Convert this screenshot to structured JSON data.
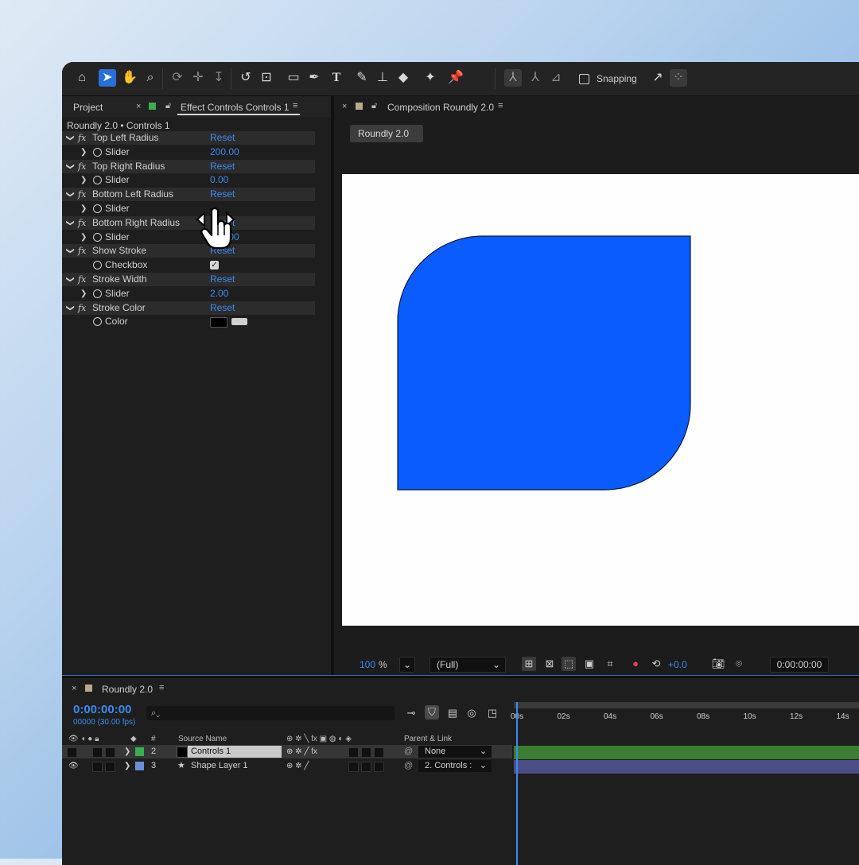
{
  "toolbar": {
    "snapping_label": "Snapping"
  },
  "project_tab": {
    "label": "Project"
  },
  "effect_controls": {
    "tab_label": "Effect Controls Controls 1",
    "title": "Roundly 2.0 • Controls 1",
    "rows": [
      {
        "type": "effect",
        "name": "Top Left Radius",
        "value": "Reset"
      },
      {
        "type": "prop",
        "name": "Slider",
        "value": "200.00"
      },
      {
        "type": "effect",
        "name": "Top Right Radius",
        "value": "Reset"
      },
      {
        "type": "prop",
        "name": "Slider",
        "value": "0.00"
      },
      {
        "type": "effect",
        "name": "Bottom Left Radius",
        "value": "Reset"
      },
      {
        "type": "prop",
        "name": "Slider",
        "value": ""
      },
      {
        "type": "effect",
        "name": "Bottom Right Radius",
        "value": "Reset"
      },
      {
        "type": "prop",
        "name": "Slider",
        "value": "200.00"
      },
      {
        "type": "effect",
        "name": "Show Stroke",
        "value": "Reset"
      },
      {
        "type": "prop",
        "name": "Checkbox",
        "value": ""
      },
      {
        "type": "effect",
        "name": "Stroke Width",
        "value": "Reset"
      },
      {
        "type": "prop",
        "name": "Slider",
        "value": "2.00"
      },
      {
        "type": "effect",
        "name": "Stroke Color",
        "value": "Reset"
      },
      {
        "type": "prop",
        "name": "Color",
        "value": ""
      }
    ]
  },
  "composition": {
    "tab_label": "Composition Roundly 2.0",
    "sub_tab": "Roundly 2.0",
    "shape_color": "#0a5cff",
    "zoom": "100",
    "zoom_unit": "%",
    "resolution": "(Full)",
    "exposure": "+0.0",
    "timecode": "0:00:00:00"
  },
  "timeline": {
    "tab_label": "Roundly 2.0",
    "timecode": "0:00:00:00",
    "frames": "00000 (30.00 fps)",
    "columns": {
      "number": "#",
      "source_name": "Source Name",
      "parent_link": "Parent & Link"
    },
    "ticks": [
      "00s",
      "02s",
      "04s",
      "06s",
      "08s",
      "10s",
      "12s",
      "14s"
    ],
    "layers": [
      {
        "num": "2",
        "name": "Controls 1",
        "parent": "None",
        "label_color": "#3cae4f",
        "track_color": "#3a7d33"
      },
      {
        "num": "3",
        "name": "Shape Layer 1",
        "parent": "2. Controls :",
        "label_color": "#6b8fd6",
        "track_color": "#4b4f86"
      }
    ]
  }
}
